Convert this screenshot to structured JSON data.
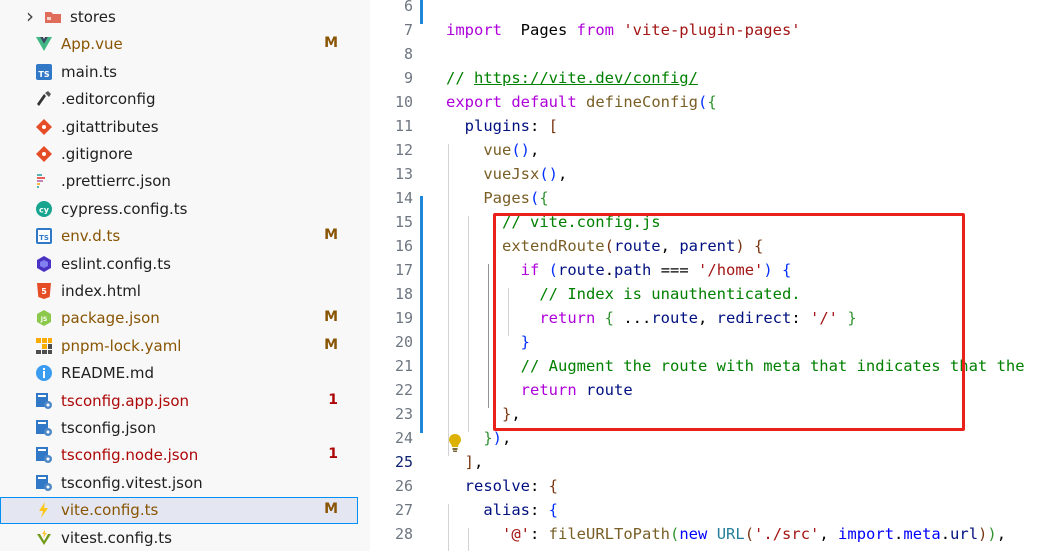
{
  "explorer": {
    "items": [
      {
        "name": "stores",
        "kind": "folder",
        "icon": "folder-icon",
        "badge": "",
        "status": ""
      },
      {
        "name": "App.vue",
        "kind": "file",
        "icon": "vue-icon",
        "badge": "M",
        "status": "modified"
      },
      {
        "name": "main.ts",
        "kind": "file",
        "icon": "typescript-icon",
        "badge": "",
        "status": ""
      },
      {
        "name": ".editorconfig",
        "kind": "file",
        "icon": "editorconfig-icon",
        "badge": "",
        "status": ""
      },
      {
        "name": ".gitattributes",
        "kind": "file",
        "icon": "git-icon",
        "badge": "",
        "status": ""
      },
      {
        "name": ".gitignore",
        "kind": "file",
        "icon": "git-icon",
        "badge": "",
        "status": ""
      },
      {
        "name": ".prettierrc.json",
        "kind": "file",
        "icon": "prettier-icon",
        "badge": "",
        "status": ""
      },
      {
        "name": "cypress.config.ts",
        "kind": "file",
        "icon": "cypress-icon",
        "badge": "",
        "status": ""
      },
      {
        "name": "env.d.ts",
        "kind": "file",
        "icon": "typescript-def-icon",
        "badge": "M",
        "status": "modified"
      },
      {
        "name": "eslint.config.ts",
        "kind": "file",
        "icon": "eslint-icon",
        "badge": "",
        "status": ""
      },
      {
        "name": "index.html",
        "kind": "file",
        "icon": "html-icon",
        "badge": "",
        "status": ""
      },
      {
        "name": "package.json",
        "kind": "file",
        "icon": "nodejs-icon",
        "badge": "M",
        "status": "modified"
      },
      {
        "name": "pnpm-lock.yaml",
        "kind": "file",
        "icon": "pnpm-icon",
        "badge": "M",
        "status": "modified"
      },
      {
        "name": "README.md",
        "kind": "file",
        "icon": "info-icon",
        "badge": "",
        "status": ""
      },
      {
        "name": "tsconfig.app.json",
        "kind": "file",
        "icon": "tsconfig-icon",
        "badge": "1",
        "status": "error"
      },
      {
        "name": "tsconfig.json",
        "kind": "file",
        "icon": "tsconfig-icon",
        "badge": "",
        "status": ""
      },
      {
        "name": "tsconfig.node.json",
        "kind": "file",
        "icon": "tsconfig-icon",
        "badge": "1",
        "status": "error"
      },
      {
        "name": "tsconfig.vitest.json",
        "kind": "file",
        "icon": "tsconfig-icon",
        "badge": "",
        "status": ""
      },
      {
        "name": "vite.config.ts",
        "kind": "file",
        "icon": "vite-icon",
        "badge": "M",
        "status": "modified",
        "selected": true
      },
      {
        "name": "vitest.config.ts",
        "kind": "file",
        "icon": "vitest-icon",
        "badge": "",
        "status": ""
      }
    ]
  },
  "editor": {
    "active_line": "25",
    "lines": [
      {
        "num": "6"
      },
      {
        "num": "7",
        "parts": [
          [
            "kw2",
            "import"
          ],
          [
            "",
            "  Pages "
          ],
          [
            "kw2",
            "from"
          ],
          [
            "str",
            " 'vite-plugin-pages'"
          ]
        ]
      },
      {
        "num": "8"
      },
      {
        "num": "9",
        "parts": [
          [
            "cm",
            "// "
          ],
          [
            "cmlink",
            "https://vite.dev/config/"
          ]
        ]
      },
      {
        "num": "10",
        "parts": [
          [
            "kw2",
            "export"
          ],
          [
            "",
            " "
          ],
          [
            "kw2",
            "default"
          ],
          [
            "",
            " "
          ],
          [
            "fn",
            "defineConfig"
          ],
          [
            "b1",
            "("
          ],
          [
            "b2",
            "{"
          ]
        ]
      },
      {
        "num": "11",
        "parts": [
          [
            "var",
            "  plugins"
          ],
          [
            "",
            ": "
          ],
          [
            "b3",
            "["
          ]
        ]
      },
      {
        "num": "12",
        "parts": [
          [
            "fn",
            "    vue"
          ],
          [
            "b1",
            "()"
          ],
          [
            "",
            ","
          ]
        ]
      },
      {
        "num": "13",
        "parts": [
          [
            "fn",
            "    vueJsx"
          ],
          [
            "b1",
            "()"
          ],
          [
            "",
            ","
          ]
        ]
      },
      {
        "num": "14",
        "parts": [
          [
            "fn",
            "    Pages"
          ],
          [
            "b1",
            "("
          ],
          [
            "b2",
            "{"
          ]
        ]
      },
      {
        "num": "15",
        "parts": [
          [
            "cm",
            "      // vite.config.js"
          ]
        ]
      },
      {
        "num": "16",
        "parts": [
          [
            "fn",
            "      extendRoute"
          ],
          [
            "b3",
            "("
          ],
          [
            "var",
            "route"
          ],
          [
            "",
            ", "
          ],
          [
            "var",
            "parent"
          ],
          [
            "b3",
            ")"
          ],
          [
            "",
            " "
          ],
          [
            "b3",
            "{"
          ]
        ]
      },
      {
        "num": "17",
        "parts": [
          [
            "kw2",
            "        if"
          ],
          [
            "",
            " "
          ],
          [
            "b1",
            "("
          ],
          [
            "var",
            "route"
          ],
          [
            "",
            "."
          ],
          [
            "var",
            "path"
          ],
          [
            "",
            " === "
          ],
          [
            "str",
            "'/home'"
          ],
          [
            "b1",
            ")"
          ],
          [
            "",
            " "
          ],
          [
            "b1",
            "{"
          ]
        ]
      },
      {
        "num": "18",
        "parts": [
          [
            "cm",
            "          // Index is unauthenticated."
          ]
        ]
      },
      {
        "num": "19",
        "parts": [
          [
            "kw2",
            "          return"
          ],
          [
            "",
            " "
          ],
          [
            "b2",
            "{"
          ],
          [
            "",
            " ..."
          ],
          [
            "var",
            "route"
          ],
          [
            "",
            ", "
          ],
          [
            "var",
            "redirect"
          ],
          [
            "",
            ": "
          ],
          [
            "str",
            "'/'"
          ],
          [
            "",
            " "
          ],
          [
            "b2",
            "}"
          ]
        ]
      },
      {
        "num": "20",
        "parts": [
          [
            "b1",
            "        }"
          ]
        ]
      },
      {
        "num": "21",
        "parts": [
          [
            "cm",
            "        // Augment the route with meta that indicates that the"
          ]
        ]
      },
      {
        "num": "22",
        "parts": [
          [
            "kw2",
            "        return"
          ],
          [
            "",
            " "
          ],
          [
            "var",
            "route"
          ]
        ]
      },
      {
        "num": "23",
        "parts": [
          [
            "b3",
            "      }"
          ],
          [
            "",
            ","
          ]
        ]
      },
      {
        "num": "24",
        "parts": [
          [
            "b2",
            "    }"
          ],
          [
            "b1",
            ")"
          ],
          [
            "",
            ","
          ]
        ]
      },
      {
        "num": "25",
        "parts": [
          [
            "b3",
            "  ]"
          ],
          [
            "",
            ","
          ]
        ]
      },
      {
        "num": "26",
        "parts": [
          [
            "var",
            "  resolve"
          ],
          [
            "",
            ": "
          ],
          [
            "b3",
            "{"
          ]
        ]
      },
      {
        "num": "27",
        "parts": [
          [
            "var",
            "    alias"
          ],
          [
            "",
            ": "
          ],
          [
            "b1",
            "{"
          ]
        ]
      },
      {
        "num": "28",
        "parts": [
          [
            "str",
            "      '@'"
          ],
          [
            "",
            ": "
          ],
          [
            "fn",
            "fileURLToPath"
          ],
          [
            "b2",
            "("
          ],
          [
            "kw",
            "new"
          ],
          [
            "",
            " "
          ],
          [
            "ty",
            "URL"
          ],
          [
            "b3",
            "("
          ],
          [
            "str",
            "'./src'"
          ],
          [
            "",
            ", "
          ],
          [
            "kw",
            "import"
          ],
          [
            "",
            "."
          ],
          [
            "kw",
            "meta"
          ],
          [
            "",
            "."
          ],
          [
            "var",
            "url"
          ],
          [
            "b3",
            ")"
          ],
          [
            "b2",
            ")"
          ],
          [
            "",
            ","
          ]
        ]
      }
    ]
  },
  "colors": {
    "modified": "#895503",
    "error": "#ad0707",
    "highlight_box": "#e8221b",
    "selection_outline": "#0090f1"
  }
}
